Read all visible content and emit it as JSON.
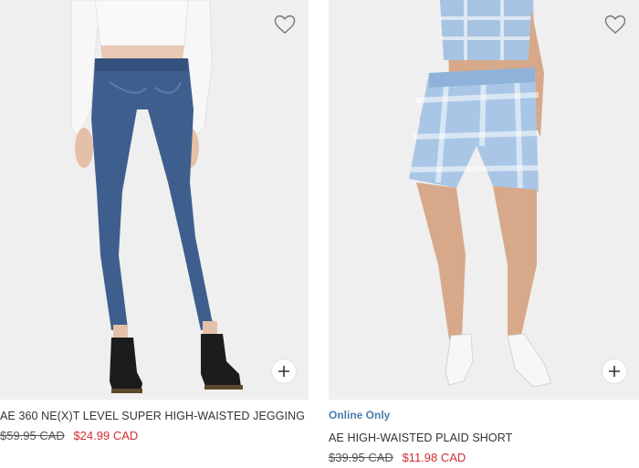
{
  "products": [
    {
      "name": "AE 360 NE(X)T LEVEL SUPER HIGH-WAISTED JEGGING",
      "badge": "",
      "original_price": "$59.95 CAD",
      "sale_price": "$24.99 CAD",
      "image_icon": "jeans-model-photo"
    },
    {
      "name": "AE HIGH-WAISTED PLAID SHORT",
      "badge": "Online Only",
      "original_price": "$39.95 CAD",
      "sale_price": "$11.98 CAD",
      "image_icon": "plaid-shorts-model-photo"
    }
  ],
  "icons": {
    "favorite": "heart-outline-icon",
    "quick_add": "plus-icon"
  },
  "colors": {
    "sale_price": "#d0302f",
    "badge": "#4a7fae",
    "text": "#333333"
  }
}
